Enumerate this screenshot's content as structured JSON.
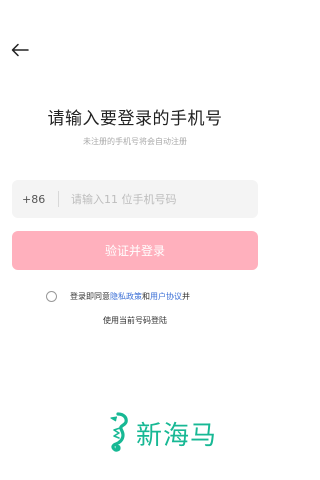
{
  "header": {
    "back_icon": "arrow-left-icon"
  },
  "login": {
    "title": "请输入要登录的手机号",
    "subtitle": "未注册的手机号将会自动注册",
    "country_code": "+86",
    "phone_placeholder": "请输入11 位手机号码",
    "phone_value": "",
    "submit_label": "验证并登录"
  },
  "agreement": {
    "prefix": "登录即同意",
    "privacy_link": "隐私政策",
    "and": "和",
    "user_agreement_link": "用户协议",
    "suffix": "并",
    "line2": "使用当前号码登陆",
    "checked": false
  },
  "brand": {
    "name": "新海马",
    "logo_icon": "seahorse-logo-icon",
    "color": "#17b894"
  },
  "colors": {
    "submit_disabled": "#ffb0bd",
    "link": "#3b6fd6",
    "input_bg": "#f4f4f4"
  }
}
